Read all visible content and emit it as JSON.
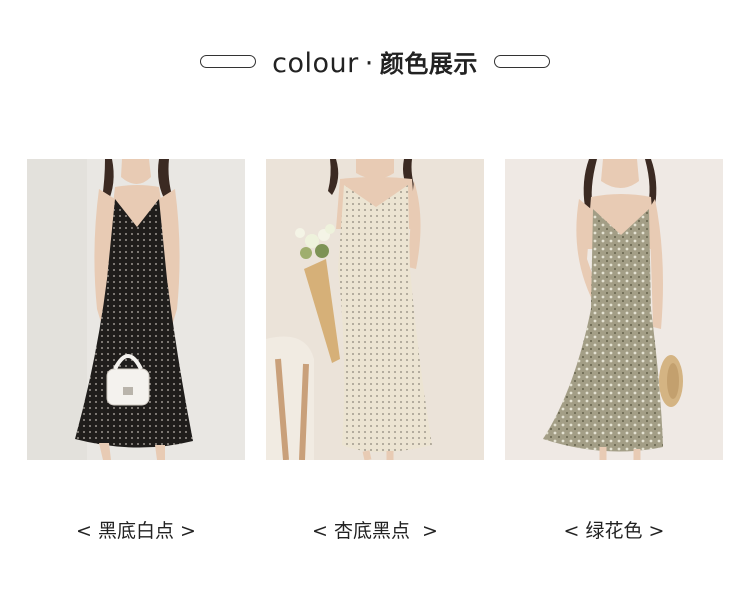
{
  "header": {
    "title_en": "colour",
    "separator": "·",
    "title_cn": "颜色展示"
  },
  "products": [
    {
      "caption": "< 黑底白点 >",
      "dress_color": "#1f1d1b",
      "dot_color": "#bdb8b0",
      "background_color": "#e9e7e3",
      "prop": "white-handbag-icon"
    },
    {
      "caption": "< 杏底黑点  >",
      "dress_color": "#ece4d2",
      "dot_color": "#8a8478",
      "background_color": "#ebe3d9",
      "prop": "flower-bouquet-icon"
    },
    {
      "caption": "< 绿花色 >",
      "dress_color": "#a39e86",
      "dot_color": "#e4e2d2",
      "background_color": "#efe9e4",
      "prop": "straw-hat-icon"
    }
  ]
}
